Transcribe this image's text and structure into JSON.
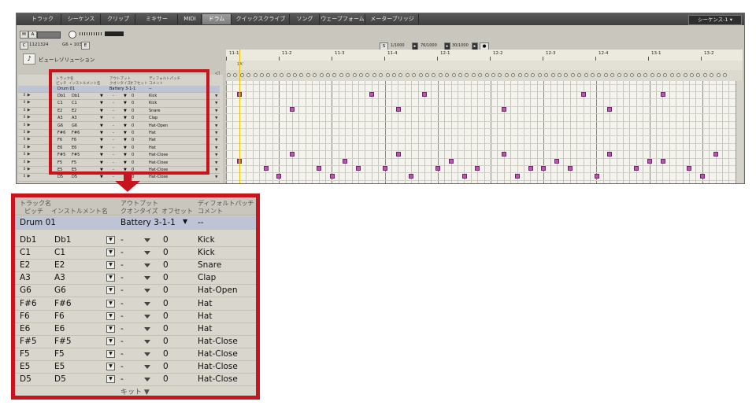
{
  "tabs": [
    "トラック",
    "シーケンス",
    "クリップ",
    "ミキサー",
    "MIDI",
    "ドラム",
    "クイックスクライブ",
    "ソング",
    "ウェーブフォーム",
    "メーターブリッジ"
  ],
  "active_tab": "ドラム",
  "sequence_selector": "シーケンス-1 ▾",
  "toolbar": {
    "m": "M",
    "a": "A",
    "s": "S",
    "position": "1121324",
    "pitch": "G6 • 103",
    "e": "E"
  },
  "resolution_label": "ビューレゾリューション",
  "transport": {
    "loop_start": "1/1000",
    "loop_len": "76/1000",
    "loop_end": "30/1000"
  },
  "ruler_bars": [
    "11-1",
    "11-2",
    "11-3",
    "11-4",
    "12-1",
    "12-2",
    "12-3",
    "12-4",
    "13-1",
    "13-2"
  ],
  "marker_text": "1A'",
  "headers": {
    "track_name": "トラック名",
    "pitch": "ピッチ",
    "instrument_name": "インストルメント名",
    "output": "アウトプット",
    "quantize": "クオンタイズ",
    "offset": "オフセット",
    "default_patch": "ディフォルトパッチ",
    "comment": "コメント"
  },
  "drum_track": {
    "name": "Drum 01",
    "output": "Battery 3-1-1",
    "patch": "--"
  },
  "rows": [
    {
      "pitch": "Db1",
      "inst": "Db1",
      "quant": "-",
      "offset": "0",
      "comment": "Kick"
    },
    {
      "pitch": "C1",
      "inst": "C1",
      "quant": "-",
      "offset": "0",
      "comment": "Kick"
    },
    {
      "pitch": "E2",
      "inst": "E2",
      "quant": "-",
      "offset": "0",
      "comment": "Snare"
    },
    {
      "pitch": "A3",
      "inst": "A3",
      "quant": "-",
      "offset": "0",
      "comment": "Clap"
    },
    {
      "pitch": "G6",
      "inst": "G6",
      "quant": "-",
      "offset": "0",
      "comment": "Hat-Open"
    },
    {
      "pitch": "F#6",
      "inst": "F#6",
      "quant": "-",
      "offset": "0",
      "comment": "Hat"
    },
    {
      "pitch": "F6",
      "inst": "F6",
      "quant": "-",
      "offset": "0",
      "comment": "Hat"
    },
    {
      "pitch": "E6",
      "inst": "E6",
      "quant": "-",
      "offset": "0",
      "comment": "Hat"
    },
    {
      "pitch": "F#5",
      "inst": "F#5",
      "quant": "-",
      "offset": "0",
      "comment": "Hat-Close"
    },
    {
      "pitch": "F5",
      "inst": "F5",
      "quant": "-",
      "offset": "0",
      "comment": "Hat-Close"
    },
    {
      "pitch": "E5",
      "inst": "E5",
      "quant": "-",
      "offset": "0",
      "comment": "Hat-Close"
    },
    {
      "pitch": "D5",
      "inst": "D5",
      "quant": "-",
      "offset": "0",
      "comment": "Hat-Close"
    }
  ],
  "kit_label": "キット",
  "notes": [
    {
      "row": 0,
      "steps": [
        0,
        20,
        28,
        52,
        64
      ]
    },
    {
      "row": 1,
      "steps": []
    },
    {
      "row": 2,
      "steps": [
        8,
        24,
        40,
        56
      ]
    },
    {
      "row": 3,
      "steps": []
    },
    {
      "row": 4,
      "steps": []
    },
    {
      "row": 5,
      "steps": []
    },
    {
      "row": 6,
      "steps": []
    },
    {
      "row": 7,
      "steps": []
    },
    {
      "row": 8,
      "steps": [
        8,
        24,
        40,
        56,
        72
      ]
    },
    {
      "row": 9,
      "steps": [
        0,
        16,
        32,
        48,
        62,
        64
      ]
    },
    {
      "row": 10,
      "steps": [
        4,
        12,
        18,
        22,
        30,
        36,
        44,
        46,
        50,
        60,
        68
      ]
    },
    {
      "row": 11,
      "steps": [
        6,
        14,
        26,
        34,
        42,
        54,
        70
      ]
    }
  ],
  "colors": {
    "accent": "#c8141c",
    "note": "#c24fb7",
    "playhead": "#e9c200"
  }
}
